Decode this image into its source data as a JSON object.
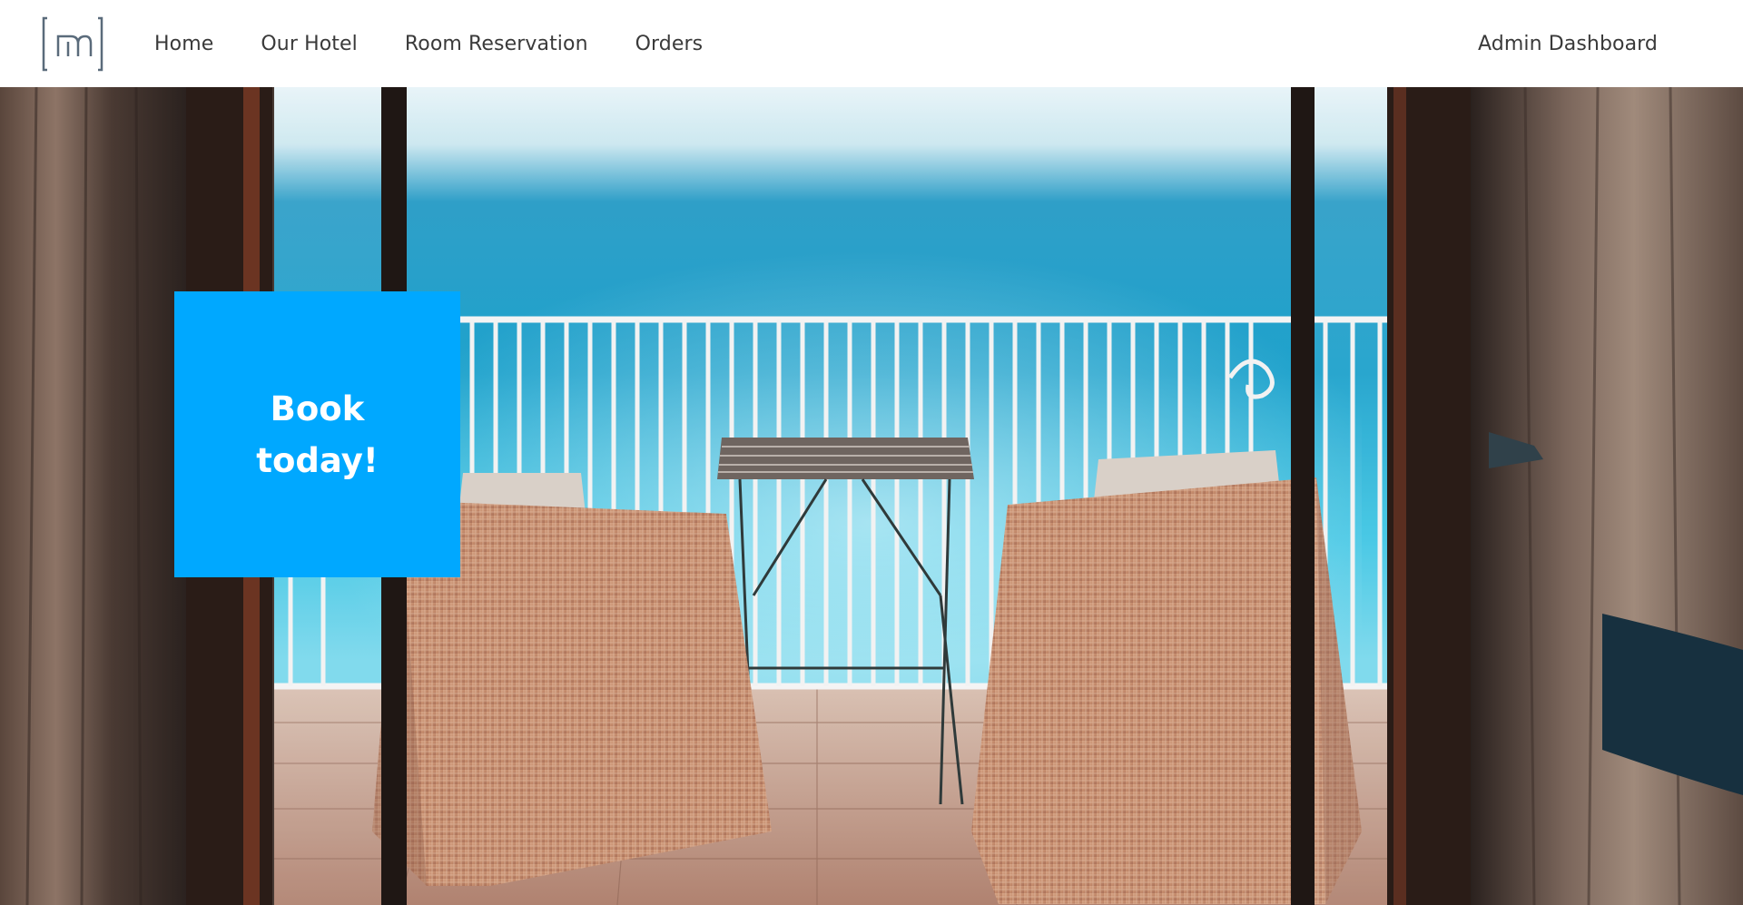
{
  "nav": {
    "items": [
      {
        "label": "Home"
      },
      {
        "label": "Our Hotel"
      },
      {
        "label": "Room Reservation"
      },
      {
        "label": "Orders"
      }
    ],
    "admin_label": "Admin Dashboard"
  },
  "logo": {
    "icon": "m-bracket-logo-icon"
  },
  "hero": {
    "image": "hotel-balcony-sea-view",
    "cta_label": "Book today!",
    "cta_color": "#00a8ff"
  },
  "colors": {
    "nav_text": "#3a3a3a",
    "nav_background": "#ffffff",
    "cta_background": "#00a8ff",
    "cta_text": "#ffffff"
  }
}
